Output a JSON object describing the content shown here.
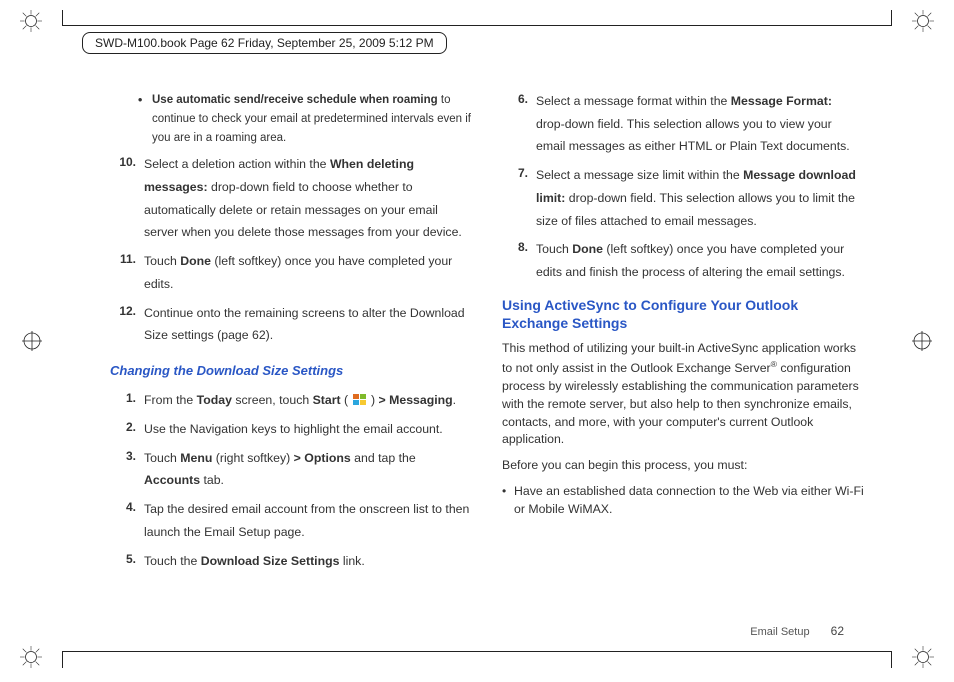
{
  "book_header": "SWD-M100.book  Page 62  Friday, September 25, 2009  5:12 PM",
  "left": {
    "bullet_top_lead": "Use automatic send/receive schedule when roaming",
    "bullet_top_rest": " to continue to check your email at predetermined intervals even if you are in a roaming area.",
    "item10_num": "10.",
    "item10_a": "Select a deletion action within the ",
    "item10_b": "When deleting messages:",
    "item10_c": " drop-down field to choose whether to automatically delete or retain messages on your email server when you delete those messages from your device.",
    "item11_num": "11.",
    "item11_a": "Touch ",
    "item11_b": "Done",
    "item11_c": " (left softkey) once you have completed your edits.",
    "item12_num": "12.",
    "item12_a": "Continue onto the remaining screens to alter the Download Size settings (page 62).",
    "subhead_blue": "Changing the Download Size Settings",
    "s1_num": "1.",
    "s1_a": "From the ",
    "s1_b": "Today",
    "s1_c": " screen, touch ",
    "s1_d": "Start",
    "s1_e": " ( ",
    "s1_f": " ) ",
    "s1_g": "> Messaging",
    "s1_h": ".",
    "s2_num": "2.",
    "s2_a": "Use the Navigation keys to highlight the email account.",
    "s3_num": "3.",
    "s3_a": "Touch ",
    "s3_b": "Menu",
    "s3_c": " (right softkey) ",
    "s3_d": "> Options",
    "s3_e": " and tap the ",
    "s3_f": "Accounts",
    "s3_g": " tab.",
    "s4_num": "4.",
    "s4_a": "Tap the desired email account from the onscreen list to then launch the Email Setup page.",
    "s5_num": "5.",
    "s5_a": "Touch the ",
    "s5_b": "Download Size Settings",
    "s5_c": " link."
  },
  "right": {
    "r6_num": "6.",
    "r6_a": "Select a message format within the ",
    "r6_b": "Message Format:",
    "r6_c": " drop-down field. This selection allows you to view your email messages as either HTML or Plain Text documents.",
    "r7_num": "7.",
    "r7_a": "Select a message size limit within the ",
    "r7_b": "Message download limit:",
    "r7_c": " drop-down field. This selection allows you to limit the size of files attached to email messages.",
    "r8_num": "8.",
    "r8_a": "Touch ",
    "r8_b": "Done",
    "r8_c": " (left softkey) once you have completed your edits and finish the process of altering the email settings.",
    "subhead": "Using ActiveSync to Configure Your Outlook Exchange Settings",
    "para1_a": "This method of utilizing your built-in ActiveSync application works to not only assist in the Outlook Exchange Server",
    "para1_sup": "®",
    "para1_b": " configuration process by wirelessly establishing the communication parameters with the remote server, but also help to then synchronize emails, contacts, and more, with your computer's current Outlook application.",
    "para2": "Before you can begin this process, you must:",
    "bullet1": "Have an established data connection to the Web via either Wi-Fi or Mobile WiMAX."
  },
  "footer": {
    "section": "Email Setup",
    "page": "62"
  }
}
